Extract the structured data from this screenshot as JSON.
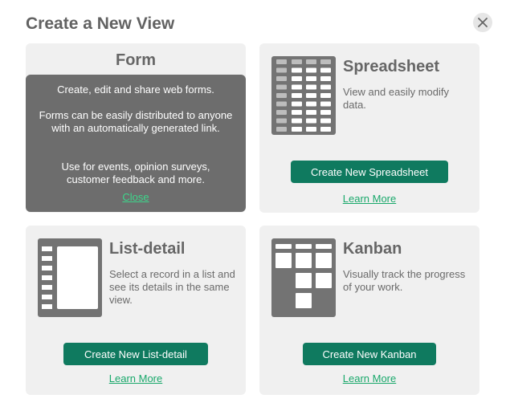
{
  "dialog": {
    "title": "Create a New View",
    "close_icon": "close-icon"
  },
  "form_card": {
    "title": "Form",
    "overlay_line1": "Create, edit and share web forms.",
    "overlay_line2": "Forms can be easily distributed to anyone with an automatically generated link.",
    "overlay_line3": "Use for events, opinion surveys, customer feedback and more.",
    "close_link": "Close"
  },
  "spreadsheet_card": {
    "title": "Spreadsheet",
    "description": "View and easily modify data.",
    "button": "Create New Spreadsheet",
    "learn_more": "Learn More",
    "icon": "spreadsheet-icon"
  },
  "list_detail_card": {
    "title": "List-detail",
    "description": "Select a record in a list and see its details in the same view.",
    "button": "Create New List-detail",
    "learn_more": "Learn More",
    "icon": "list-detail-icon"
  },
  "kanban_card": {
    "title": "Kanban",
    "description": "Visually track the progress of your work.",
    "button": "Create New Kanban",
    "learn_more": "Learn More",
    "icon": "kanban-icon"
  },
  "colors": {
    "accent": "#0f7a5f",
    "link": "#19a86b",
    "card_bg": "#f0f0f0",
    "icon_gray": "#737373"
  }
}
